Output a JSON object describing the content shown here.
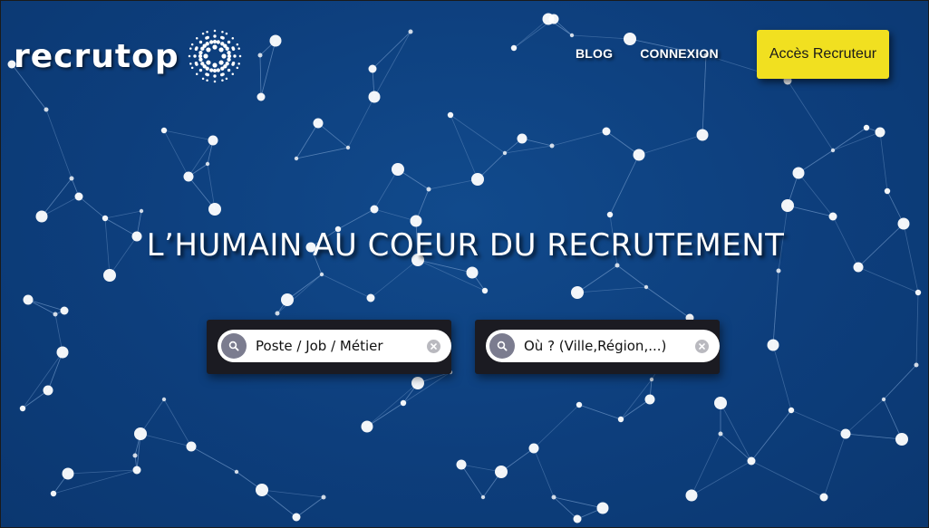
{
  "brand": {
    "name": "recrutop",
    "logo_mark": "starburst-dots-icon"
  },
  "nav": {
    "blog": "BLOG",
    "login": "CONNEXION"
  },
  "cta": {
    "recruiter_access": "Accès Recruteur"
  },
  "hero": {
    "headline": "L’HUMAIN AU COEUR DU RECRUTEMENT"
  },
  "search": {
    "job": {
      "placeholder": "Poste / Job / Métier",
      "icon": "search-icon",
      "clear_icon": "clear-icon"
    },
    "location": {
      "placeholder": "Où ? (Ville,Région,...)",
      "icon": "search-icon",
      "clear_icon": "clear-icon"
    }
  },
  "colors": {
    "background": "#0d3e7c",
    "accent_button": "#f1e020",
    "search_frame": "#1b1b22",
    "search_icon_bg": "#7b7c8f",
    "text": "#ffffff"
  }
}
